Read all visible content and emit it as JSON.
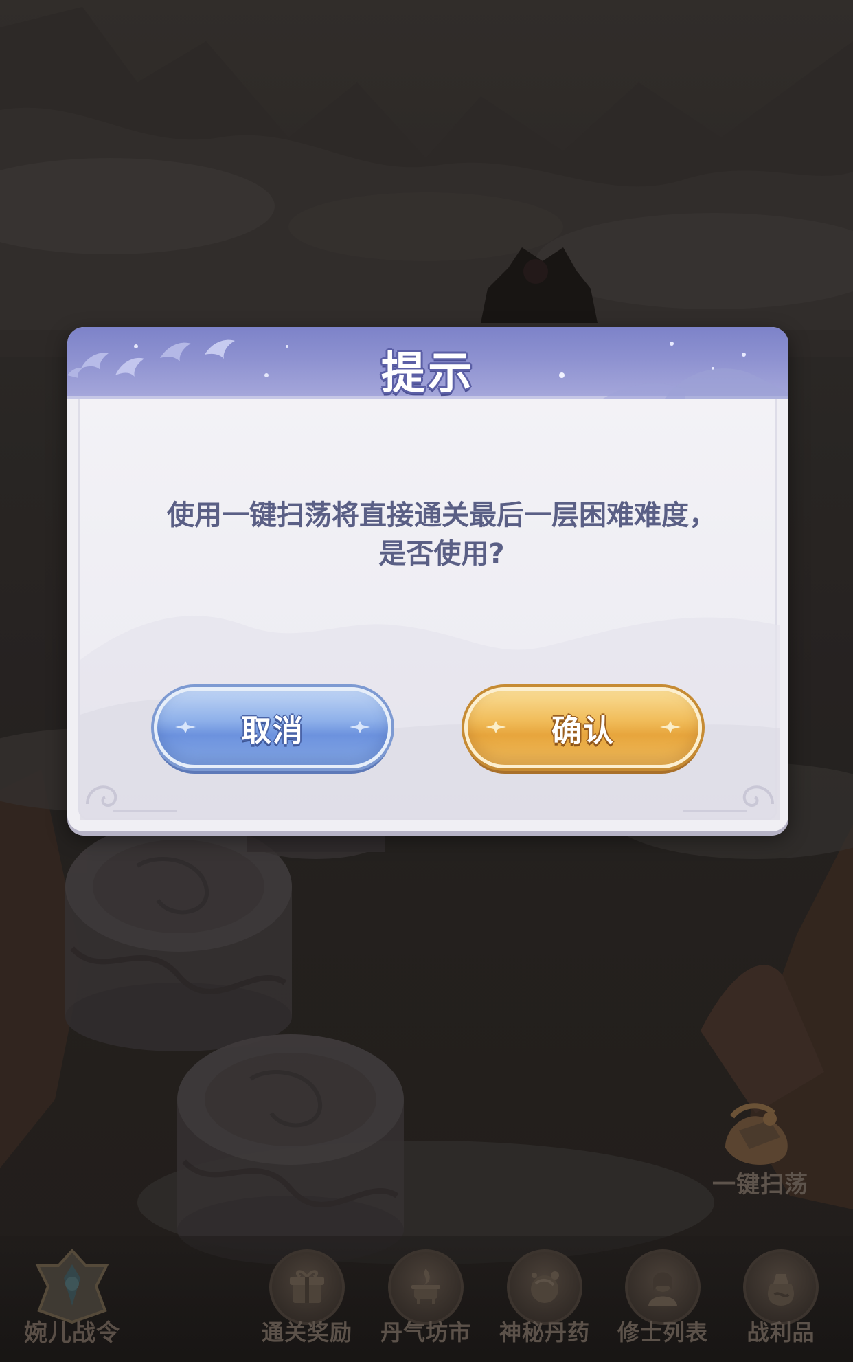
{
  "dialog": {
    "title": "提示",
    "message_line1": "使用一键扫荡将直接通关最后一层困难难度，",
    "message_line2": "是否使用?",
    "cancel_label": "取消",
    "confirm_label": "确认"
  },
  "side_button": {
    "label": "一键扫荡",
    "icon": "sweep-icon"
  },
  "bottom_menu": {
    "pass": {
      "label": "婉儿战令",
      "icon": "battle-pass-emblem-icon"
    },
    "items": [
      {
        "label": "通关奖励",
        "icon": "gift-box-icon"
      },
      {
        "label": "丹气坊市",
        "icon": "incense-burner-icon"
      },
      {
        "label": "神秘丹药",
        "icon": "pill-icon"
      },
      {
        "label": "修士列表",
        "icon": "cultivator-portrait-icon"
      },
      {
        "label": "战利品",
        "icon": "treasure-bag-icon"
      }
    ]
  },
  "colors": {
    "header": "#8d91d0",
    "message_text": "#5a5f85",
    "cancel_button": "#8fb1ea",
    "confirm_button": "#f1bd5b",
    "overlay": "#2b2725"
  }
}
